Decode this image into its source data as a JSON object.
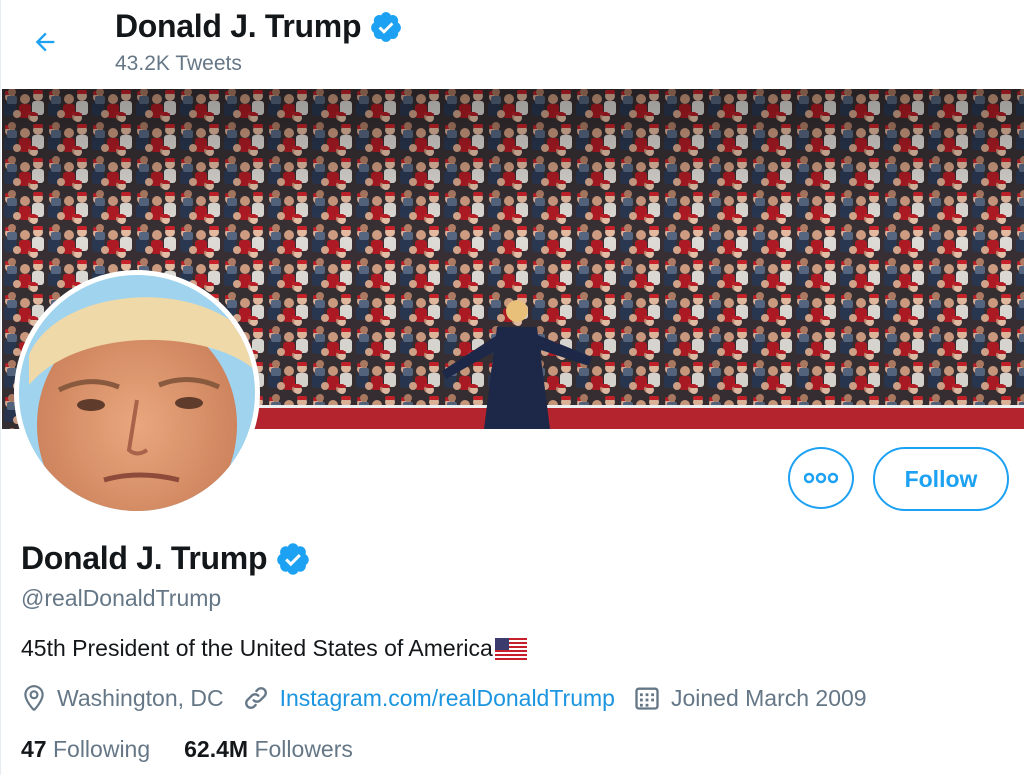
{
  "header": {
    "title": "Donald J. Trump",
    "tweet_count": "43.2K Tweets"
  },
  "profile": {
    "name": "Donald J. Trump",
    "handle": "@realDonaldTrump",
    "bio": "45th President of the United States of America",
    "location": "Washington, DC",
    "website": "Instagram.com/realDonaldTrump",
    "joined": "Joined March 2009",
    "verified": true
  },
  "actions": {
    "follow_label": "Follow",
    "more_icon": "more-options-icon"
  },
  "stats": {
    "following_count": "47",
    "following_label": "Following",
    "followers_count": "62.4M",
    "followers_label": "Followers"
  },
  "colors": {
    "accent": "#1da1f2",
    "link": "#1b95e0",
    "secondary_text": "#657786",
    "primary_text": "#14171a"
  }
}
